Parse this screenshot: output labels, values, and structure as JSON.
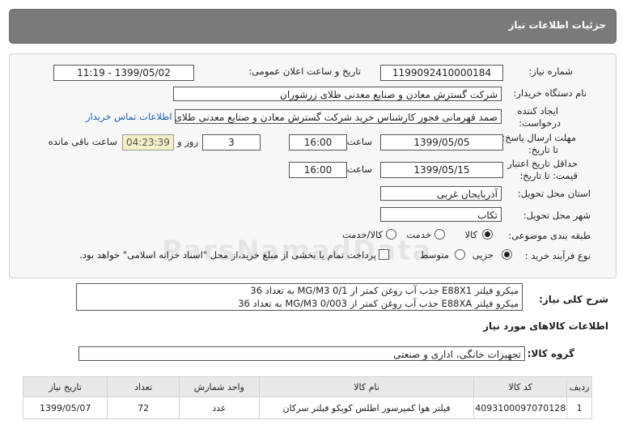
{
  "header": {
    "title": "جزئیات اطلاعات نیاز"
  },
  "form": {
    "need_number_label": "شماره نیاز:",
    "need_number": "1199092410000184",
    "announce_label": "تاریخ و ساعت اعلان عمومی:",
    "announce_value": "1399/05/02 - 11:19",
    "buyer_org_label": "نام دستگاه خریدار:",
    "buyer_org": "شرکت گسترش معادن و صنایع معدنی طلای زرشوران",
    "creator_label_1": "ایجاد کننده",
    "creator_label_2": "درخواست:",
    "creator": "صمد قهرمانی فجور کارشناس خرید شرکت گسترش معادن و صنایع معدنی طلای زر",
    "contact_link": "اطلاعات تماس خریدار",
    "deadline_label_1": "مهلت ارسال پاسخ:",
    "deadline_label_2": "تا تاریخ:",
    "deadline_date": "1399/05/05",
    "time_label": "ساعت",
    "deadline_time": "16:00",
    "days_count": "3",
    "days_label": "روز و",
    "remaining_time": "04:23:39",
    "remaining_label": "ساعت باقی مانده",
    "validity_label_1": "حداقل تاریخ اعتبار",
    "validity_label_2": "قیمت: تا تاریخ:",
    "validity_date": "1399/05/15",
    "validity_time": "16:00",
    "province_label": "استان محل تحویل:",
    "province": "آذربایجان غربی",
    "city_label": "شهر محل تحویل:",
    "city": "تکاب",
    "category_label": "طبقه بندی موضوعی:",
    "category_options": [
      "کالا",
      "خدمت",
      "کالا/خدمت"
    ],
    "process_label": "نوع فرآیند خرید :",
    "process_options": [
      "جزیی",
      "متوسط"
    ],
    "payment_note": "پرداخت تمام یا بخشی از مبلغ خرید،از محل \"اسناد خزانه اسلامی\" خواهد بود."
  },
  "description": {
    "label": "شرح کلی نیاز:",
    "line1": "میکرو فیلتر   E88X1 جذب آب روغن کمتر از MG/M3 0/1    به تعداد 36",
    "line2": "میکرو فیلتر   E88XA جذب آب روغن کمتر از MG/M3 0/003    به تعداد 36"
  },
  "goods": {
    "section_title": "اطلاعات کالاهای مورد نیاز",
    "group_label": "گروه کالا:",
    "group_value": "تجهیزات خانگی، اداری و صنعتی",
    "columns": [
      "ردیف",
      "کد کالا",
      "نام کالا",
      "واحد شمارش",
      "تعداد",
      "تاریخ نیاز"
    ],
    "rows": [
      [
        "1",
        "4093100097070128",
        "فیلتر هوا کمپرسور اطلس کوپکو فیلتر سرکان",
        "عدد",
        "72",
        "1399/05/07"
      ]
    ]
  },
  "watermark": "ParsNamadData"
}
